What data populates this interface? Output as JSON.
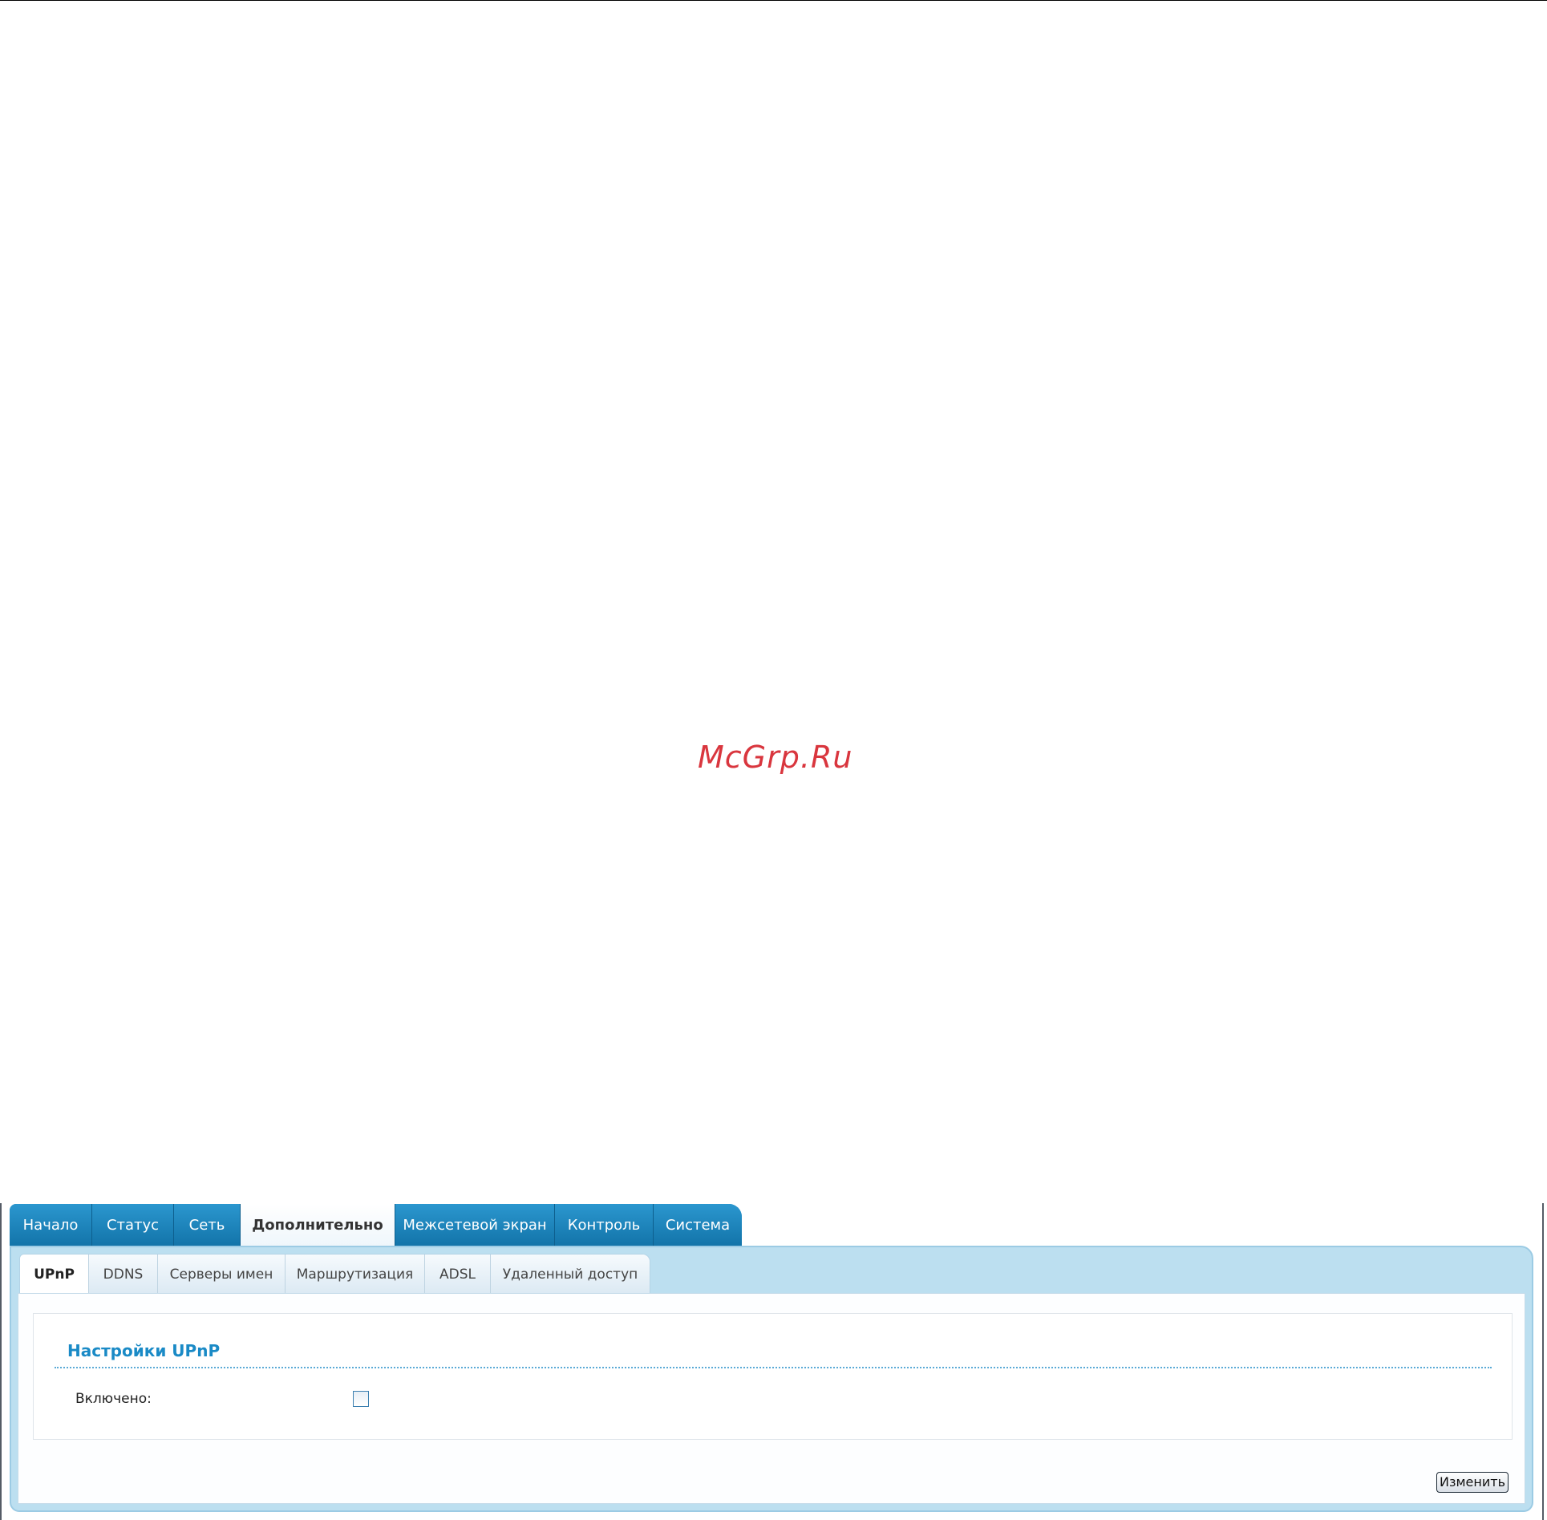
{
  "watermark": "McGrp.Ru",
  "main_tabs": [
    {
      "label": "Начало"
    },
    {
      "label": "Статус"
    },
    {
      "label": "Сеть"
    },
    {
      "label": "Дополнительно",
      "active": true
    },
    {
      "label": "Межсетевой экран"
    },
    {
      "label": "Контроль"
    },
    {
      "label": "Система"
    }
  ],
  "sub_tabs": [
    {
      "label": "UPnP",
      "active": true
    },
    {
      "label": "DDNS"
    },
    {
      "label": "Серверы имен"
    },
    {
      "label": "Маршрутизация"
    },
    {
      "label": "ADSL"
    },
    {
      "label": "Удаленный доступ"
    }
  ],
  "section": {
    "title": "Настройки UPnP",
    "enabled_label": "Включено:",
    "enabled_checked": false
  },
  "actions": {
    "change_label": "Изменить"
  },
  "colors": {
    "tab_blue": "#1883bd",
    "panel_blue": "#bcdff0",
    "title_blue": "#1a8ac6",
    "watermark_red": "#d9363e"
  }
}
